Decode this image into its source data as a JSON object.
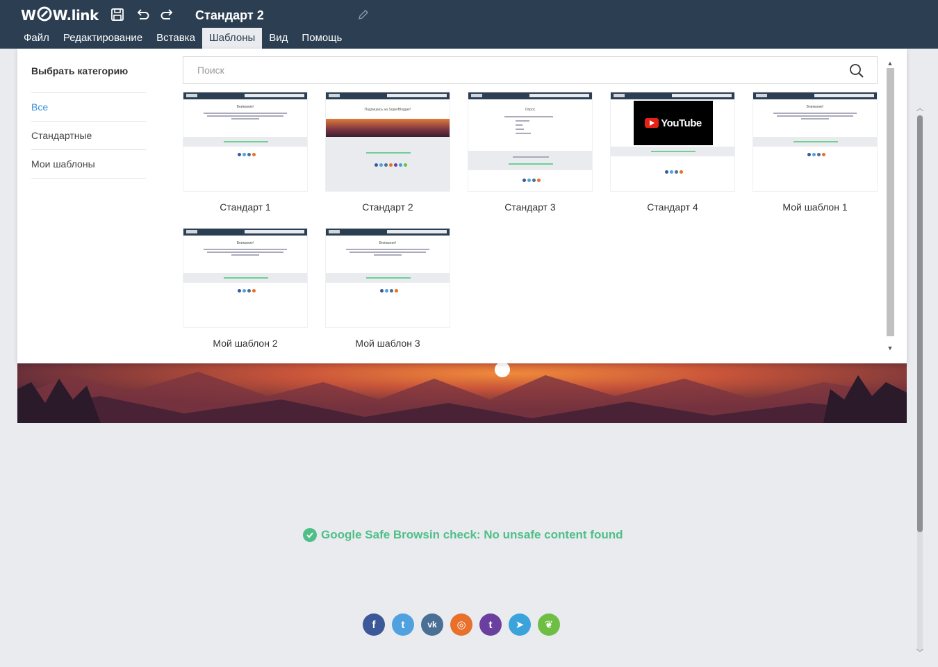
{
  "header": {
    "logo": "W",
    "logo_tail": "W.link",
    "doc_title": "Стандарт 2",
    "icons": [
      "save-icon",
      "undo-icon",
      "redo-icon",
      "pencil-icon"
    ]
  },
  "menu": [
    {
      "label": "Файл"
    },
    {
      "label": "Редактирование"
    },
    {
      "label": "Вставка"
    },
    {
      "label": "Шаблоны",
      "active": true
    },
    {
      "label": "Вид"
    },
    {
      "label": "Помощь"
    }
  ],
  "dialog": {
    "category_title": "Выбрать категорию",
    "categories": [
      {
        "label": "Все",
        "active": true
      },
      {
        "label": "Стандартные"
      },
      {
        "label": "Мои шаблоны"
      }
    ],
    "search_placeholder": "Поиск",
    "templates": [
      {
        "label": "Стандарт 1",
        "variant": "standard"
      },
      {
        "label": "Стандарт 2",
        "variant": "banner",
        "subtitle": "Подпишись на SuperBlogger!"
      },
      {
        "label": "Стандарт 3",
        "variant": "poll",
        "subtitle": "Опрос"
      },
      {
        "label": "Стандарт 4",
        "variant": "youtube",
        "video_label": "YouTube"
      },
      {
        "label": "Мой шаблон 1",
        "variant": "standard"
      },
      {
        "label": "Мой шаблон 2",
        "variant": "standard"
      },
      {
        "label": "Мой шаблон 3",
        "variant": "standard"
      }
    ],
    "thumb_heading": "Внимание!"
  },
  "page": {
    "safe_check": "Google Safe Browsin check: No unsafe content found",
    "socials": [
      {
        "name": "facebook-icon",
        "glyph": "f",
        "color": "#3b5998"
      },
      {
        "name": "twitter-icon",
        "glyph": "t",
        "color": "#4fa1e0"
      },
      {
        "name": "vk-icon",
        "glyph": "vk",
        "color": "#4a6f95"
      },
      {
        "name": "instagram-icon",
        "glyph": "◎",
        "color": "#e8702a"
      },
      {
        "name": "tumblr-icon",
        "glyph": "t",
        "color": "#6b3fa0"
      },
      {
        "name": "telegram-icon",
        "glyph": "➤",
        "color": "#3aa3dc"
      },
      {
        "name": "evernote-icon",
        "glyph": "❦",
        "color": "#6fbe44"
      }
    ]
  },
  "colors": {
    "header": "#2c3e52",
    "accent_blue": "#3a8fd6",
    "safe_green": "#4fbf87"
  }
}
